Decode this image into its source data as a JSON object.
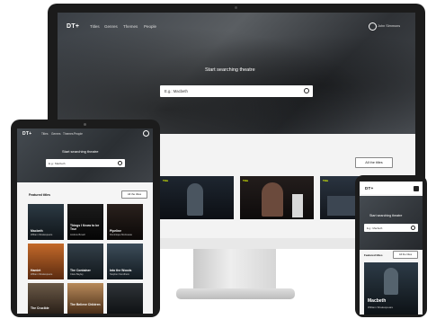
{
  "brand": {
    "logo": "DT+",
    "accent": "#e5ff00"
  },
  "desktop": {
    "nav": [
      "Titles",
      "Genres",
      "Themes",
      "People"
    ],
    "account_name": "John Simmons",
    "search_title": "Start searching theatre",
    "search_placeholder": "E.g.: Macbeth",
    "all_titles_button": "All the titles",
    "tile_tag": "Title"
  },
  "tablet": {
    "nav": [
      "Titles",
      "Genres",
      "Themes",
      "People"
    ],
    "search_title": "Start searching theatre",
    "search_placeholder": "E.g.: Macbeth",
    "featured_label": "Featured titles",
    "all_titles_button": "All the titles",
    "tiles": [
      {
        "title": "Macbeth",
        "subtitle": "William Shakespeare"
      },
      {
        "title": "Things I Know to be True",
        "subtitle": "Andrew Bovell"
      },
      {
        "title": "Pipeline",
        "subtitle": "Dominique Morisseau"
      },
      {
        "title": "Hamlet",
        "subtitle": "William Shakespeare"
      },
      {
        "title": "The Container",
        "subtitle": "Clare Bayley"
      },
      {
        "title": "Into the Woods",
        "subtitle": "Stephen Sondheim"
      },
      {
        "title": "The Crucible",
        "subtitle": ""
      },
      {
        "title": "The Believe Children",
        "subtitle": ""
      },
      {
        "title": "",
        "subtitle": ""
      }
    ]
  },
  "phone": {
    "search_title": "Start searching theatre",
    "search_placeholder": "E.g.: Macbeth",
    "featured_label": "Featured titles",
    "all_titles_button": "All the titles",
    "tile": {
      "title": "Macbeth",
      "subtitle": "William Shakespeare"
    }
  }
}
